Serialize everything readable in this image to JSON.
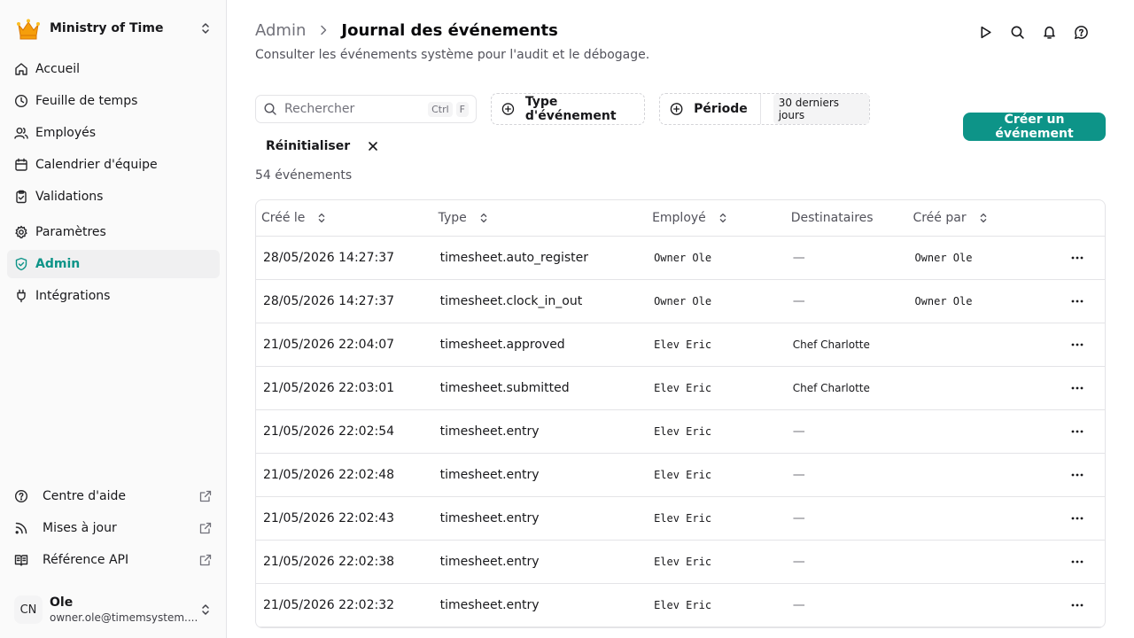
{
  "org": {
    "name": "Ministry of Time"
  },
  "nav": [
    {
      "label": "Accueil",
      "icon": "home-icon"
    },
    {
      "label": "Feuille de temps",
      "icon": "clock-icon"
    },
    {
      "label": "Employés",
      "icon": "users-icon"
    },
    {
      "label": "Calendrier d'équipe",
      "icon": "calendar-icon"
    },
    {
      "label": "Validations",
      "icon": "clipboard-check-icon"
    },
    {
      "label": "Paramètres",
      "icon": "gear-icon"
    },
    {
      "label": "Admin",
      "icon": "shield-check-icon",
      "active": true
    },
    {
      "label": "Intégrations",
      "icon": "plug-icon"
    }
  ],
  "bottom_links": [
    {
      "label": "Centre d'aide",
      "icon": "help-circle-icon"
    },
    {
      "label": "Mises à jour",
      "icon": "rss-icon"
    },
    {
      "label": "Référence API",
      "icon": "book-icon"
    }
  ],
  "user": {
    "initials": "CN",
    "name": "Ole",
    "email": "owner.ole@timemsystem...."
  },
  "header": {
    "breadcrumb_parent": "Admin",
    "title": "Journal des événements",
    "subtitle": "Consulter les événements système pour l'audit et le débogage."
  },
  "toolbar": {
    "search_placeholder": "Rechercher",
    "kbd_ctrl": "Ctrl",
    "kbd_f": "F",
    "filter_type": "Type d'événement",
    "filter_period": "Période",
    "period_value": "30 derniers jours",
    "reset": "Réinitialiser",
    "create": "Créer un événement",
    "count": "54 événements"
  },
  "colors": {
    "accent": "#0d9488"
  },
  "table": {
    "columns": [
      "Créé le",
      "Type",
      "Employé",
      "Destinataires",
      "Créé par"
    ],
    "rows": [
      {
        "created": "28/05/2026 14:27:37",
        "type": "timesheet.auto_register",
        "employee": "Owner Ole",
        "recipients": "—",
        "by": "Owner Ole"
      },
      {
        "created": "28/05/2026 14:27:37",
        "type": "timesheet.clock_in_out",
        "employee": "Owner Ole",
        "recipients": "—",
        "by": "Owner Ole"
      },
      {
        "created": "21/05/2026 22:04:07",
        "type": "timesheet.approved",
        "employee": "Elev Eric",
        "recipients": "Chef Charlotte",
        "by": ""
      },
      {
        "created": "21/05/2026 22:03:01",
        "type": "timesheet.submitted",
        "employee": "Elev Eric",
        "recipients": "Chef Charlotte",
        "by": ""
      },
      {
        "created": "21/05/2026 22:02:54",
        "type": "timesheet.entry",
        "employee": "Elev Eric",
        "recipients": "—",
        "by": ""
      },
      {
        "created": "21/05/2026 22:02:48",
        "type": "timesheet.entry",
        "employee": "Elev Eric",
        "recipients": "—",
        "by": ""
      },
      {
        "created": "21/05/2026 22:02:43",
        "type": "timesheet.entry",
        "employee": "Elev Eric",
        "recipients": "—",
        "by": ""
      },
      {
        "created": "21/05/2026 22:02:38",
        "type": "timesheet.entry",
        "employee": "Elev Eric",
        "recipients": "—",
        "by": ""
      },
      {
        "created": "21/05/2026 22:02:32",
        "type": "timesheet.entry",
        "employee": "Elev Eric",
        "recipients": "—",
        "by": ""
      }
    ]
  }
}
